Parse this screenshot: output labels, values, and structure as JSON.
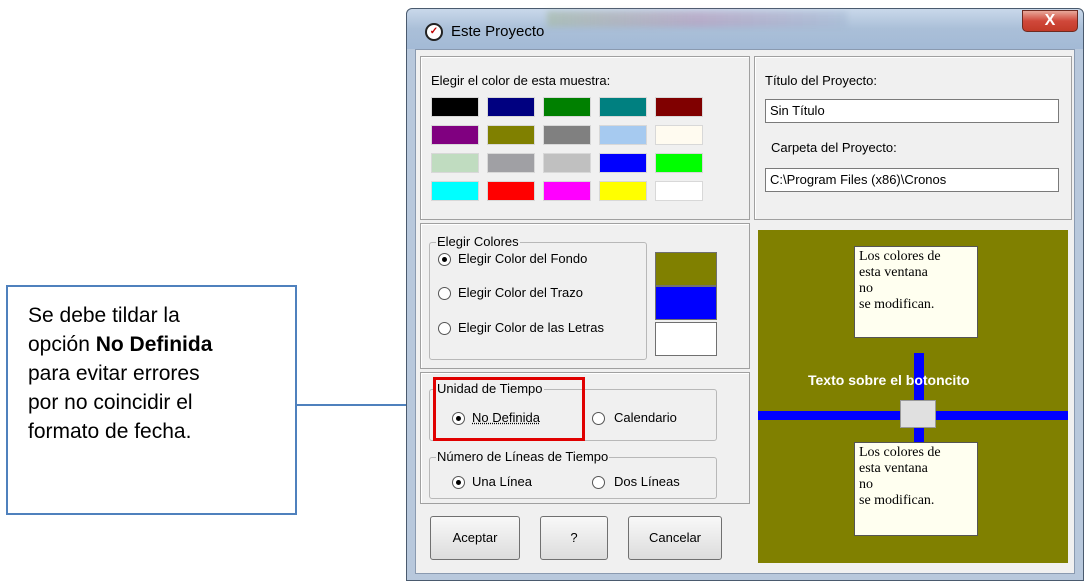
{
  "callout": {
    "line1": "Se debe tildar la",
    "line2_prefix": "opción ",
    "line2_bold": "No Definida",
    "line3": "para evitar errores",
    "line4": "por no coincidir el",
    "line5": "formato de fecha."
  },
  "window": {
    "title": "Este Proyecto",
    "close": "X"
  },
  "palette": {
    "label": "Elegir el color de esta muestra:",
    "colors": [
      "#000000",
      "#000080",
      "#008000",
      "#008080",
      "#800000",
      "#800080",
      "#808000",
      "#808080",
      "#a6caf0",
      "#fffbf0",
      "#c0dcc0",
      "#a0a0a4",
      "#c0c0c0",
      "#0000ff",
      "#00ff00",
      "#00ffff",
      "#ff0000",
      "#ff00ff",
      "#ffff00",
      "#ffffff"
    ]
  },
  "project": {
    "title_label": "Título del Proyecto:",
    "title_value": "Sin Título",
    "folder_label": "Carpeta del Proyecto:",
    "folder_value": "C:\\Program Files (x86)\\Cronos"
  },
  "colors_group": {
    "label": "Elegir Colores",
    "option_background": "Elegir Color del Fondo",
    "option_stroke": "Elegir Color del Trazo",
    "option_letters": "Elegir Color de las Letras",
    "background_color": "#808000",
    "stroke_color": "#0000ff",
    "letters_color": "#ffffff",
    "selected": "background"
  },
  "time_unit": {
    "label": "Unidad de Tiempo",
    "option_undefined": "No Definida",
    "option_calendar": "Calendario",
    "selected": "undefined"
  },
  "lines": {
    "label": "Número de Líneas de Tiempo",
    "option_one": "Una Línea",
    "option_two": "Dos Líneas",
    "selected": "one"
  },
  "buttons": {
    "accept": "Aceptar",
    "help": "?",
    "cancel": "Cancelar"
  },
  "preview": {
    "note_top": "Los colores de\nesta ventana\nno\nse modifican.",
    "note_bottom": "Los colores de\nesta ventana\nno\nse modifican.",
    "button_text": "Texto sobre el botoncito"
  }
}
